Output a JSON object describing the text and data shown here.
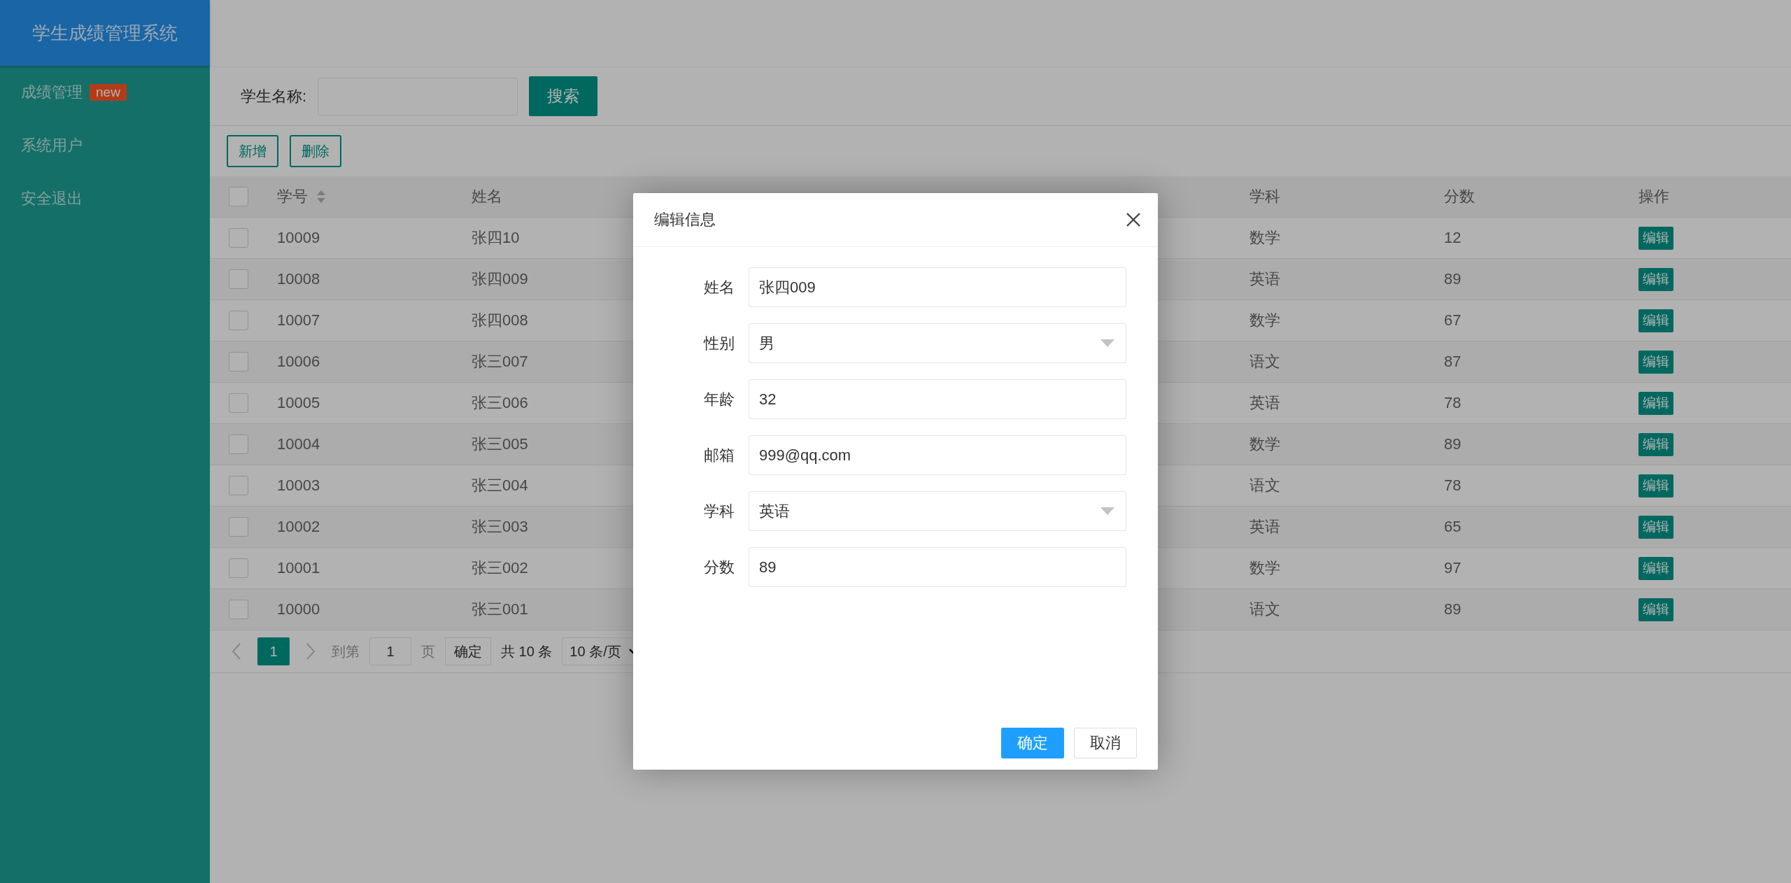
{
  "sidebar": {
    "title": "学生成绩管理系统",
    "items": [
      {
        "label": "成绩管理",
        "badge": "new"
      },
      {
        "label": "系统用户"
      },
      {
        "label": "安全退出"
      }
    ]
  },
  "search": {
    "label": "学生名称:",
    "button": "搜索"
  },
  "toolbar": {
    "buttons": [
      "新增",
      "删除"
    ]
  },
  "table": {
    "header_checked": false,
    "columns": [
      {
        "label": "学号",
        "sortable": true
      },
      {
        "label": "姓名",
        "sortable": false
      },
      {
        "label": "学科",
        "sortable": false
      },
      {
        "label": "分数",
        "sortable": false
      },
      {
        "label": "操作",
        "sortable": false
      }
    ],
    "rows": [
      {
        "checked": false,
        "cells": [
          "10009",
          "张四10",
          "数学",
          "12"
        ],
        "action": "编辑"
      },
      {
        "checked": false,
        "cells": [
          "10008",
          "张四009",
          "英语",
          "89"
        ],
        "action": "编辑"
      },
      {
        "checked": false,
        "cells": [
          "10007",
          "张四008",
          "数学",
          "67"
        ],
        "action": "编辑"
      },
      {
        "checked": false,
        "cells": [
          "10006",
          "张三007",
          "语文",
          "87"
        ],
        "action": "编辑"
      },
      {
        "checked": false,
        "cells": [
          "10005",
          "张三006",
          "英语",
          "78"
        ],
        "action": "编辑"
      },
      {
        "checked": false,
        "cells": [
          "10004",
          "张三005",
          "数学",
          "89"
        ],
        "action": "编辑"
      },
      {
        "checked": false,
        "cells": [
          "10003",
          "张三004",
          "语文",
          "78"
        ],
        "action": "编辑"
      },
      {
        "checked": false,
        "cells": [
          "10002",
          "张三003",
          "英语",
          "65"
        ],
        "action": "编辑"
      },
      {
        "checked": false,
        "cells": [
          "10001",
          "张三002",
          "数学",
          "97"
        ],
        "action": "编辑"
      },
      {
        "checked": false,
        "cells": [
          "10000",
          "张三001",
          "语文",
          "89"
        ],
        "action": "编辑"
      }
    ]
  },
  "pagination": {
    "pages": [
      {
        "label": "1",
        "selected": true
      }
    ],
    "goto_label": "到第",
    "goto_value": "1",
    "page_unit": "页",
    "confirm": "确定",
    "total": "共 10 条",
    "page_size": "10 条/页"
  },
  "modal": {
    "title": "编辑信息",
    "fields": [
      {
        "label": "姓名",
        "kind": "input",
        "value": "张四009"
      },
      {
        "label": "性别",
        "kind": "select",
        "value": "男"
      },
      {
        "label": "年龄",
        "kind": "input",
        "value": "32"
      },
      {
        "label": "邮箱",
        "kind": "input",
        "value": "999@qq.com"
      },
      {
        "label": "学科",
        "kind": "select",
        "value": "英语"
      },
      {
        "label": "分数",
        "kind": "input",
        "value": "89"
      }
    ],
    "buttons": [
      {
        "label": "确定",
        "kind": "primary"
      },
      {
        "label": "取消",
        "kind": "default"
      }
    ]
  }
}
